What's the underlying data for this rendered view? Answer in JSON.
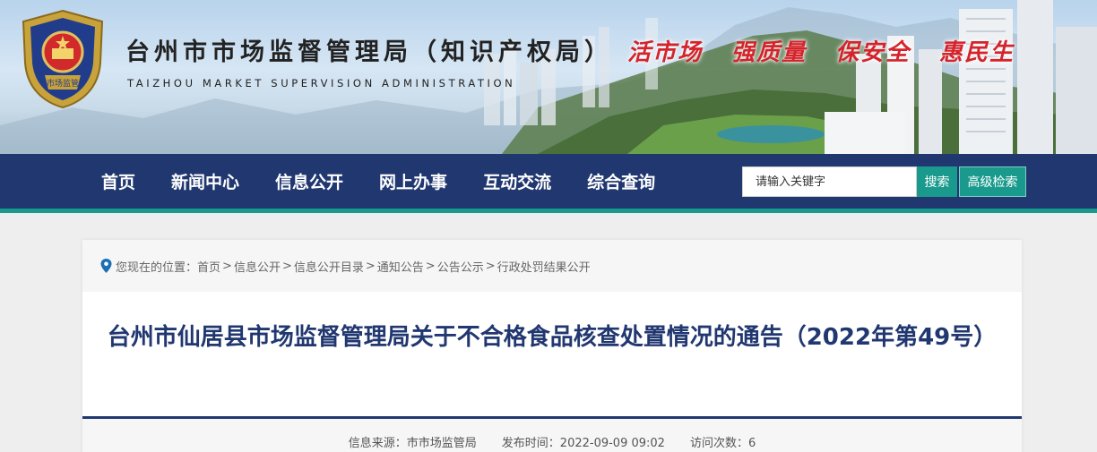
{
  "header": {
    "title": "台州市市场监督管理局（知识产权局）",
    "title_en": "TAIZHOU MARKET SUPERVISION ADMINISTRATION",
    "emblem_text": "市场监管",
    "slogans": [
      "活市场",
      "强质量",
      "保安全",
      "惠民生"
    ]
  },
  "nav": {
    "items": [
      {
        "label": "首页"
      },
      {
        "label": "新闻中心"
      },
      {
        "label": "信息公开"
      },
      {
        "label": "网上办事"
      },
      {
        "label": "互动交流"
      },
      {
        "label": "综合查询"
      }
    ],
    "search": {
      "placeholder": "请输入关键字",
      "search_label": "搜索",
      "advanced_label": "高级检索"
    }
  },
  "breadcrumb": {
    "prefix": "您现在的位置：",
    "items": [
      "首页",
      "信息公开",
      "信息公开目录",
      "通知公告",
      "公告公示",
      "行政处罚结果公开"
    ],
    "separator": ">"
  },
  "article": {
    "title": "台州市仙居县市场监督管理局关于不合格食品核查处置情况的通告（2022年第49号）",
    "source_label": "信息来源：",
    "source": "市市场监管局",
    "date_label": "发布时间：",
    "date": "2022-09-09 09:02",
    "views_label": "访问次数：",
    "views": "6"
  },
  "colors": {
    "nav_bg": "#213770",
    "accent": "#1a9a8c",
    "slogan": "#d4232b",
    "title": "#213770"
  }
}
